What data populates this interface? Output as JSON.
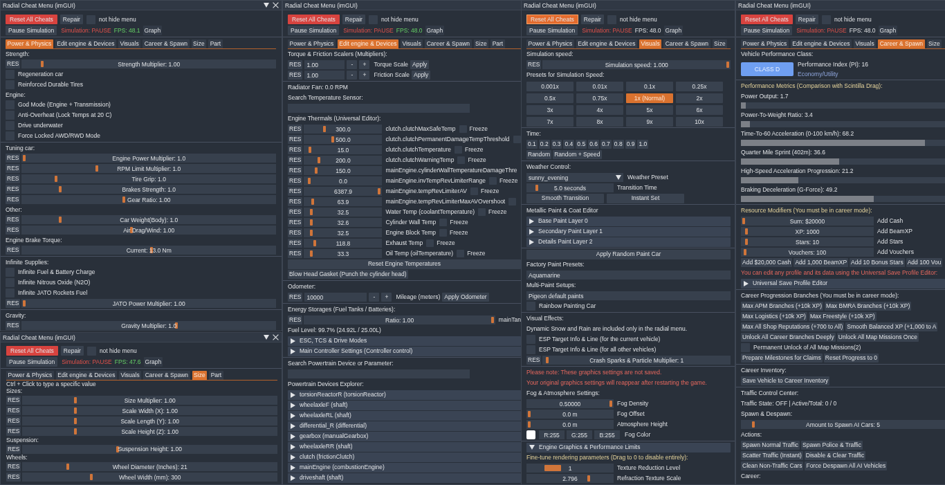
{
  "columns": [
    {
      "windows": [
        {
          "title": "Radial Cheat Menu (imGUI)",
          "collapse_button": true,
          "close_button": true,
          "toolbar": {
            "reset": {
              "label": "Reset All Cheats",
              "hovered": false
            },
            "repair": "Repair",
            "pin": {
              "label": "not hide menu",
              "checked": false
            },
            "pause": "Pause Simulation",
            "status": "Simulation: PAUSE",
            "fps": {
              "text": "FPS: 48.1",
              "highlighted": true
            },
            "graph": "Graph"
          },
          "tabs": [
            {
              "label": "Power & Physics",
              "selected": true
            },
            {
              "label": "Edit engine & Devices",
              "selected": false
            },
            {
              "label": "Visuals",
              "selected": false
            },
            {
              "label": "Career & Spawn",
              "selected": false
            },
            {
              "label": "Size",
              "selected": false
            },
            {
              "label": "Part",
              "selected": false
            }
          ],
          "items": [
            {
              "kind": "text",
              "text": "Strength:"
            },
            {
              "kind": "slider",
              "reset": "RES",
              "display": "Strength Multiplier: 1.00",
              "level": 0.07
            },
            {
              "kind": "checkbox",
              "label": "Regeneration car",
              "checked": false
            },
            {
              "kind": "checkbox",
              "label": "Reinforced Durable Tires",
              "checked": false
            },
            {
              "kind": "text",
              "text": "Engine:"
            },
            {
              "kind": "checkbox",
              "label": "God Mode (Engine + Transmission)",
              "checked": false
            },
            {
              "kind": "checkbox",
              "label": "Anti-Overheat (Lock Temps at 20 C)",
              "checked": false
            },
            {
              "kind": "checkbox",
              "label": "Drive underwater",
              "checked": false
            },
            {
              "kind": "checkbox",
              "label": "Force Locked AWD/RWD Mode",
              "checked": false
            },
            {
              "kind": "separator"
            },
            {
              "kind": "text",
              "text": "Tuning car:"
            },
            {
              "kind": "slider",
              "reset": "RES",
              "display": "Engine Power Multiplier: 1.0",
              "level": 0
            },
            {
              "kind": "slider",
              "reset": "RES",
              "display": "RPM Limit Multiplier: 1.0",
              "level": 0.29
            },
            {
              "kind": "slider",
              "reset": "RES",
              "display": "Tire Grip: 1.0",
              "level": 0.127
            },
            {
              "kind": "slider",
              "reset": "RES",
              "display": "Brakes Strength: 1.0",
              "level": 0.144
            },
            {
              "kind": "slider",
              "reset": "RES",
              "display": "Gear Ratio: 1.00",
              "level": 0.4
            },
            {
              "kind": "text",
              "text": "Other:"
            },
            {
              "kind": "slider",
              "reset": "RES",
              "display": "Car Weight(Body): 1.0",
              "level": 0.144
            },
            {
              "kind": "slider",
              "reset": "RES",
              "display": "Air Drag/Wind: 1.00",
              "level": 0.43
            },
            {
              "kind": "text",
              "text": "Engine Brake Torque:"
            },
            {
              "kind": "slider",
              "reset": "RES",
              "display": "Current: 13.0 Nm",
              "level": 0.51
            },
            {
              "kind": "separator"
            },
            {
              "kind": "text",
              "text": "Infinite Supplies:"
            },
            {
              "kind": "checkbox",
              "label": "Infinite Fuel & Battery Charge",
              "checked": false
            },
            {
              "kind": "checkbox",
              "label": "Infinite Nitrous Oxide (N2O)",
              "checked": false
            },
            {
              "kind": "checkbox",
              "label": "Infinite JATO Rockets Fuel",
              "checked": false
            },
            {
              "kind": "slider",
              "reset": "RES",
              "display": "JATO Power Multiplier: 1.00",
              "level": 0
            },
            {
              "kind": "separator"
            },
            {
              "kind": "text",
              "text": "Gravity:"
            },
            {
              "kind": "slider",
              "reset": "RES",
              "display": "Gravity Multiplier: 1.0",
              "level": 0.61
            }
          ]
        },
        {
          "title": "Radial Cheat Menu (imGUI)",
          "collapse_button": true,
          "close_button": true,
          "toolbar": {
            "reset": {
              "label": "Reset All Cheats",
              "hovered": false
            },
            "repair": "Repair",
            "pin": {
              "label": "not hide menu",
              "checked": false
            },
            "pause": "Pause Simulation",
            "status": "Simulation: PAUSE",
            "fps": {
              "text": "FPS: 47.6",
              "highlighted": true
            },
            "graph": "Graph"
          },
          "tabs": [
            {
              "label": "Power & Physics",
              "selected": false
            },
            {
              "label": "Edit engine & Devices",
              "selected": false
            },
            {
              "label": "Visuals",
              "selected": false
            },
            {
              "label": "Career & Spawn",
              "selected": false
            },
            {
              "label": "Size",
              "selected": true
            },
            {
              "label": "Part",
              "selected": false
            }
          ],
          "items": [
            {
              "kind": "text",
              "text": "Ctrl + Click to type a specific value"
            },
            {
              "kind": "text",
              "text": "Sizes:"
            },
            {
              "kind": "slider",
              "reset": "RES",
              "display": "Size Multiplier: 1.00",
              "level": 0.2
            },
            {
              "kind": "slider",
              "reset": "RES",
              "display": "Scale Width (X): 1.00",
              "level": 0.2
            },
            {
              "kind": "slider",
              "reset": "RES",
              "display": "Scale Length (Y): 1.00",
              "level": 0.2
            },
            {
              "kind": "slider",
              "reset": "RES",
              "display": "Scale Height (Z): 1.00",
              "level": 0.2
            },
            {
              "kind": "text",
              "text": "Suspension:"
            },
            {
              "kind": "slider",
              "reset": "RES",
              "display": "Suspension Height: 1.00",
              "level": 0.37
            },
            {
              "kind": "text",
              "text": "Wheels:"
            },
            {
              "kind": "slider",
              "reset": "RES",
              "display": "Wheel Diameter (Inches): 21",
              "level": 0.17
            },
            {
              "kind": "slider",
              "reset": "RES",
              "display": "Wheel Width (mm): 300",
              "level": 0.265
            }
          ]
        }
      ]
    },
    {
      "windows": [
        {
          "title": "Radial Cheat Menu (imGUI)",
          "toolbar": {
            "reset": {
              "label": "Reset All Cheats",
              "hovered": false
            },
            "repair": "Repair",
            "pin": {
              "label": "not hide menu",
              "checked": false
            },
            "pause": "Pause Simulation",
            "status": "Simulation: PAUSE",
            "fps": {
              "text": "FPS: 48.0",
              "highlighted": true
            },
            "graph": "Graph"
          },
          "tabs": [
            {
              "label": "Power & Physics",
              "selected": false
            },
            {
              "label": "Edit engine & Devices",
              "selected": true
            },
            {
              "label": "Visuals",
              "selected": false
            },
            {
              "label": "Career & Spawn",
              "selected": false
            },
            {
              "label": "Size",
              "selected": false
            },
            {
              "label": "Part",
              "selected": false
            }
          ],
          "items": [
            {
              "kind": "text",
              "text": "Torque & Friction Scalers (Multipliers):"
            },
            {
              "kind": "stepper",
              "reset": "RES",
              "value": "1.00",
              "minus": "-",
              "plus": "+",
              "label": "Torque Scale",
              "apply": "Apply"
            },
            {
              "kind": "stepper",
              "reset": "RES",
              "value": "1.00",
              "minus": "-",
              "plus": "+",
              "label": "Friction Scale",
              "apply": "Apply"
            },
            {
              "kind": "separator"
            },
            {
              "kind": "text",
              "text": "Radiator Fan: 0.0 RPM"
            },
            {
              "kind": "text",
              "text": "Search Temperature Sensor:"
            },
            {
              "kind": "input"
            },
            {
              "kind": "text",
              "text": "Engine Thermals (Universal Editor):"
            },
            {
              "kind": "thermal",
              "reset": "RES",
              "value": "300.0",
              "level": 0.24,
              "label": "clutch.clutchMaxSafeTemp",
              "freeze": {
                "label": "Freeze",
                "checked": false
              }
            },
            {
              "kind": "thermal",
              "reset": "RES",
              "value": "500.0",
              "level": 0.36,
              "label": "clutch.clutchPermanentDamageTempThreshold",
              "freeze": {
                "checked": false
              }
            },
            {
              "kind": "thermal",
              "reset": "RES",
              "value": "15.0",
              "level": 0.04,
              "label": "clutch.clutchTemperature",
              "freeze": {
                "label": "Freeze",
                "checked": false
              }
            },
            {
              "kind": "thermal",
              "reset": "RES",
              "value": "200.0",
              "level": 0.17,
              "label": "clutch.clutchWarningTemp",
              "freeze": {
                "label": "Freeze",
                "checked": false
              }
            },
            {
              "kind": "thermal",
              "reset": "RES",
              "value": "150.0",
              "level": 0.13,
              "label": "mainEngine.cylinderWallTemperatureDamageThre"
            },
            {
              "kind": "thermal",
              "reset": "RES",
              "value": "0.0",
              "level": 0.03,
              "label": "mainEngine.invTempRevLimiterRange",
              "freeze": {
                "label": "Freeze",
                "checked": false
              }
            },
            {
              "kind": "thermal",
              "reset": "RES",
              "value": "6387.9",
              "level": 1,
              "label": "mainEngine.tempRevLimiterAV",
              "freeze": {
                "label": "Freeze",
                "checked": false
              }
            },
            {
              "kind": "thermal",
              "reset": "RES",
              "value": "63.9",
              "level": 0.08,
              "label": "mainEngine.tempRevLimiterMaxAVOvershoot",
              "freeze": {
                "checked": false
              }
            },
            {
              "kind": "thermal",
              "reset": "RES",
              "value": "32.5",
              "level": 0.06,
              "label": "Water Temp (coolantTemperature)",
              "freeze": {
                "label": "Freeze",
                "checked": false
              }
            },
            {
              "kind": "thermal",
              "reset": "RES",
              "value": "32.6",
              "level": 0.06,
              "label": "Cylinder Wall Temp",
              "freeze": {
                "label": "Freeze",
                "checked": false
              }
            },
            {
              "kind": "thermal",
              "reset": "RES",
              "value": "32.5",
              "level": 0.06,
              "label": "Engine Block Temp",
              "freeze": {
                "label": "Freeze",
                "checked": false
              }
            },
            {
              "kind": "thermal",
              "reset": "RES",
              "value": "118.8",
              "level": 0.11,
              "label": "Exhaust Temp",
              "freeze": {
                "label": "Freeze",
                "checked": false
              }
            },
            {
              "kind": "thermal",
              "reset": "RES",
              "value": "33.3",
              "level": 0.06,
              "label": "Oil Temp (oilTemperature)",
              "freeze": {
                "label": "Freeze",
                "checked": false
              }
            },
            {
              "kind": "wide_button",
              "label": "Reset Engine Temperatures"
            },
            {
              "kind": "buttons",
              "buttons": [
                "Blow Head Gasket (Punch the cylinder head)"
              ]
            },
            {
              "kind": "separator"
            },
            {
              "kind": "text",
              "text": "Odometer:"
            },
            {
              "kind": "odometer",
              "reset": "RES",
              "value": "10000",
              "minus": "-",
              "plus": "+",
              "label": "Mileage (meters)",
              "apply": "Apply Odometer"
            },
            {
              "kind": "separator"
            },
            {
              "kind": "text",
              "text": "Energy Storages (Fuel Tanks / Batteries):"
            },
            {
              "kind": "slider",
              "reset": "RES",
              "display": "Ratio: 1.00",
              "level": 1,
              "label": "mainTan"
            },
            {
              "kind": "text",
              "text": "Fuel Level: 99.7% (24.92L / 25.00L)"
            },
            {
              "kind": "header",
              "label": "ESC, TCS & Drive Modes",
              "expanded": false
            },
            {
              "kind": "header",
              "label": "Main Controller Settings (Controller control)",
              "expanded": false
            },
            {
              "kind": "separator"
            },
            {
              "kind": "text",
              "text": "Search Powertrain Device or Parameter:"
            },
            {
              "kind": "input"
            },
            {
              "kind": "text",
              "text": "Powertrain Devices Explorer:"
            },
            {
              "kind": "header",
              "label": "torsionReactorR (torsionReactor)",
              "expanded": false
            },
            {
              "kind": "header",
              "label": "wheelaxleF (shaft)",
              "expanded": false
            },
            {
              "kind": "header",
              "label": "wheelaxleRL (shaft)",
              "expanded": false
            },
            {
              "kind": "header",
              "label": "differential_R (differential)",
              "expanded": false
            },
            {
              "kind": "header",
              "label": "gearbox (manualGearbox)",
              "expanded": false
            },
            {
              "kind": "header",
              "label": "wheelaxleRR (shaft)",
              "expanded": false
            },
            {
              "kind": "header",
              "label": "clutch (frictionClutch)",
              "expanded": false
            },
            {
              "kind": "header",
              "label": "mainEngine (combustionEngine)",
              "expanded": false
            },
            {
              "kind": "header",
              "label": "driveshaft (shaft)",
              "expanded": false
            }
          ]
        }
      ]
    },
    {
      "windows": [
        {
          "title": "Radial Cheat Menu (imGUI)",
          "toolbar": {
            "reset": {
              "label": "Reset All Cheats",
              "hovered": true
            },
            "repair": "Repair",
            "pin": {
              "label": "not hide menu",
              "checked": false
            },
            "pause": "Pause Simulation",
            "status": "Simulation: PAUSE",
            "fps": {
              "text": "FPS: 48.0",
              "highlighted": false
            },
            "graph": "Graph"
          },
          "tabs": [
            {
              "label": "Power & Physics",
              "selected": false
            },
            {
              "label": "Edit engine & Devices",
              "selected": false
            },
            {
              "label": "Visuals",
              "selected": true
            },
            {
              "label": "Career & Spawn",
              "selected": false
            },
            {
              "label": "Size",
              "selected": false
            }
          ],
          "items": [
            {
              "kind": "text",
              "text": "Simulation speed:"
            },
            {
              "kind": "slider",
              "reset": "RES",
              "display": "Simulation speed: 1.000",
              "level": 1
            },
            {
              "kind": "text",
              "text": "Presets for Simulation Speed:"
            },
            {
              "kind": "presets",
              "buttons": [
                {
                  "label": "0.001x",
                  "selected": false
                },
                {
                  "label": "0.01x",
                  "selected": false
                },
                {
                  "label": "0.1x",
                  "selected": false
                },
                {
                  "label": "0.25x",
                  "selected": false
                },
                {
                  "label": "0.5x",
                  "selected": false
                },
                {
                  "label": "0.75x",
                  "selected": false
                },
                {
                  "label": "1x (Normal)",
                  "selected": true
                },
                {
                  "label": "2x",
                  "selected": false
                },
                {
                  "label": "3x",
                  "selected": false
                },
                {
                  "label": "4x",
                  "selected": false
                },
                {
                  "label": "5x",
                  "selected": false
                },
                {
                  "label": "6x",
                  "selected": false
                },
                {
                  "label": "7x",
                  "selected": false
                },
                {
                  "label": "8x",
                  "selected": false
                },
                {
                  "label": "9x",
                  "selected": false
                },
                {
                  "label": "10x",
                  "selected": false
                }
              ]
            },
            {
              "kind": "separator"
            },
            {
              "kind": "text",
              "text": "Time:"
            },
            {
              "kind": "buttons",
              "buttons": [
                "0.1",
                "0.2",
                "0.3",
                "0.4",
                "0.5",
                "0.6",
                "0.7",
                "0.8",
                "0.9",
                "1.0"
              ]
            },
            {
              "kind": "buttons",
              "buttons": [
                "Random",
                "Random + Speed"
              ]
            },
            {
              "kind": "separator"
            },
            {
              "kind": "text",
              "text": "Weather Control:"
            },
            {
              "kind": "combo",
              "value": "sunny_evening",
              "label": "Weather Preset"
            },
            {
              "kind": "drag",
              "display": "5.0 seconds",
              "level": 0.09,
              "label": "Transition Time"
            },
            {
              "kind": "wide_buttons",
              "buttons": [
                "Smooth Transition",
                "Instant Set"
              ]
            },
            {
              "kind": "separator"
            },
            {
              "kind": "text",
              "text": "Metallic Paint & Coat Editor"
            },
            {
              "kind": "header",
              "label": "Base Paint Layer 0",
              "expanded": false
            },
            {
              "kind": "header",
              "label": "Secondary Paint Layer 1",
              "expanded": false
            },
            {
              "kind": "header",
              "label": "Details Paint Layer 2",
              "expanded": false
            },
            {
              "kind": "separator"
            },
            {
              "kind": "wide_button",
              "label": "Apply Random Paint Car"
            },
            {
              "kind": "text",
              "text": "Factory Paint Presets:"
            },
            {
              "kind": "field",
              "value": "Aquamarine"
            },
            {
              "kind": "text",
              "text": "Multi-Paint Setups:"
            },
            {
              "kind": "field",
              "value": "Pigeon default paints"
            },
            {
              "kind": "checkbox",
              "label": "Rainbow Painting Car",
              "checked": false
            },
            {
              "kind": "separator"
            },
            {
              "kind": "text",
              "text": "Visual Effects:"
            },
            {
              "kind": "text",
              "text": "Dynamic Snow and Rain are included only in the radial menu."
            },
            {
              "kind": "checkbox",
              "label": "ESP Target Info & Line (for the current vehicle)",
              "checked": false
            },
            {
              "kind": "checkbox",
              "label": "ESP Target Info & Line (for all other vehicles)",
              "checked": false
            },
            {
              "kind": "slider",
              "reset": "RES",
              "display": "Crash Sparks & Particle Multiplier: 1",
              "level": 0.01
            },
            {
              "kind": "separator"
            },
            {
              "kind": "text",
              "text": "Please note: These graphics settings are not saved.",
              "warning": true
            },
            {
              "kind": "text",
              "text": "Your original graphics settings will reappear after restarting the game.",
              "warning": true
            },
            {
              "kind": "text",
              "text": "Fog & Atmosphere Settings:"
            },
            {
              "kind": "drag",
              "display": "0.50000",
              "level": 1,
              "label": "Fog Density"
            },
            {
              "kind": "drag",
              "display": "0.0 m",
              "level": 0,
              "label": "Fog Offset"
            },
            {
              "kind": "drag",
              "display": "0.0 m",
              "level": 0,
              "label": "Atmosphere Height"
            },
            {
              "kind": "color_edit",
              "color": "#ffffff",
              "channels": [
                "R:255",
                "G:255",
                "B:255"
              ],
              "label": "Fog Color"
            },
            {
              "kind": "separator"
            },
            {
              "kind": "header",
              "label": "Engine Graphics & Performance Limits",
              "expanded": true
            },
            {
              "kind": "text",
              "text": "Fine-tune rendering parameters (Drag to 0 to disable entirely):",
              "highlight": true
            },
            {
              "kind": "int_drag",
              "display": "1",
              "level": 0.245,
              "label": "Texture Reduction Level"
            },
            {
              "kind": "drag",
              "display": "2.796",
              "level": 0.73,
              "label": "Refraction Texture Scale"
            }
          ]
        }
      ]
    },
    {
      "windows": [
        {
          "title": "Radial Cheat Menu (imGUI)",
          "toolbar": {
            "reset": {
              "label": "Reset All Cheats",
              "hovered": false
            },
            "repair": "Repair",
            "pin": {
              "label": "not hide menu",
              "checked": false
            },
            "pause": "Pause Simulation",
            "status": "Simulation: PAUSE",
            "fps": {
              "text": "FPS: 48.0",
              "highlighted": false
            },
            "graph": "Graph"
          },
          "tabs": [
            {
              "label": "Power & Physics",
              "selected": false
            },
            {
              "label": "Edit engine & Devices",
              "selected": false
            },
            {
              "label": "Visuals",
              "selected": false
            },
            {
              "label": "Career & Spawn",
              "selected": true
            },
            {
              "label": "Size",
              "selected": false
            }
          ],
          "items": [
            {
              "kind": "text",
              "text": "Vehicle Performance Class:"
            },
            {
              "kind": "class",
              "badge": "CLASS D",
              "index": "Performance Index (PI): 16",
              "category": "Economy/Utility"
            },
            {
              "kind": "separator"
            },
            {
              "kind": "text",
              "text": "Performance Metrics (Comparison with Scintilla Drag):",
              "highlight": true
            },
            {
              "kind": "progress",
              "label": "Power Output: 1.7",
              "level": 0.024
            },
            {
              "kind": "progress",
              "label": "Power-To-Weight Ratio: 3.4",
              "level": 0.044
            },
            {
              "kind": "progress",
              "label": "Time-To-60 Acceleration (0-100 km/h): 68.2",
              "level": 0.9
            },
            {
              "kind": "progress",
              "label": "Quarter Mile Sprint (402m): 36.6",
              "level": 0.48
            },
            {
              "kind": "progress",
              "label": "High-Speed Acceleration Progression: 21.2",
              "level": 0.28
            },
            {
              "kind": "progress",
              "label": "Braking Deceleration (G-Force): 49.2",
              "level": 0.65
            },
            {
              "kind": "separator"
            },
            {
              "kind": "text",
              "text": "Resource Modifiers (You must be in career mode):",
              "highlight": true
            },
            {
              "kind": "amount",
              "display": "Sum: $20000",
              "level": 0,
              "label": "Add Cash"
            },
            {
              "kind": "amount",
              "display": "XP: 1000",
              "level": 0.02,
              "label": "Add BeamXP"
            },
            {
              "kind": "amount",
              "display": "Stars: 10",
              "level": 0.02,
              "label": "Add Stars"
            },
            {
              "kind": "amount",
              "display": "Vouchers: 100",
              "level": 0.01,
              "label": "Add Vouchers"
            },
            {
              "kind": "buttons",
              "buttons": [
                "Add $20,000 Cash",
                "Add 1,000 BeamXP",
                "Add 10 Bonus Stars",
                "Add 100 Vou"
              ]
            },
            {
              "kind": "text",
              "text": "You can edit any profile and its data using the Universal Save Profile Editor:",
              "warning": true
            },
            {
              "kind": "header",
              "label": "Universal Save Profile Editor",
              "expanded": false
            },
            {
              "kind": "separator"
            },
            {
              "kind": "text",
              "text": "Career Progression Branches (You must be in career mode):"
            },
            {
              "kind": "buttons",
              "buttons": [
                "Max APM Branches (+10k XP)",
                "Max BMRA Branches (+10k XP)"
              ]
            },
            {
              "kind": "buttons",
              "buttons": [
                "Max Logistics (+10k XP)",
                "Max Freestyle (+10k XP)"
              ]
            },
            {
              "kind": "buttons",
              "buttons": [
                "Max All Shop Reputations (+700 to All)",
                "Smooth Balanced XP (+1,000 to A"
              ]
            },
            {
              "kind": "buttons",
              "buttons": [
                "Unlock All Career Branches Deeply",
                "Unlock All Map Missions Once"
              ]
            },
            {
              "kind": "checkbox",
              "label": "Permanent Unlock of All Map Missions(2)",
              "checked": false
            },
            {
              "kind": "buttons",
              "buttons": [
                "Prepare Milestones for Claims",
                "Reset Progress to 0"
              ]
            },
            {
              "kind": "separator"
            },
            {
              "kind": "text",
              "text": "Career Inventory:"
            },
            {
              "kind": "buttons",
              "buttons": [
                "Save Vehicle to Career Inventory"
              ]
            },
            {
              "kind": "separator"
            },
            {
              "kind": "text",
              "text": "Traffic Control Center:"
            },
            {
              "kind": "text",
              "text": "Traffic State: OFF | Active/Total: 0 / 0"
            },
            {
              "kind": "text",
              "text": "Spawn & Despawn:"
            },
            {
              "kind": "slider",
              "display": "Amount to Spawn AI Cars: 5",
              "level": 0.05
            },
            {
              "kind": "text",
              "text": "Actions:"
            },
            {
              "kind": "buttons",
              "buttons": [
                "Spawn Normal Traffic",
                "Spawn Police & Traffic"
              ]
            },
            {
              "kind": "buttons",
              "buttons": [
                "Scatter Traffic (Instant)",
                "Disable & Clear Traffic"
              ]
            },
            {
              "kind": "buttons",
              "buttons": [
                "Clean Non-Traffic Cars",
                "Force Despawn All AI Vehicles"
              ]
            },
            {
              "kind": "text",
              "text": "Career:"
            }
          ]
        }
      ]
    }
  ]
}
